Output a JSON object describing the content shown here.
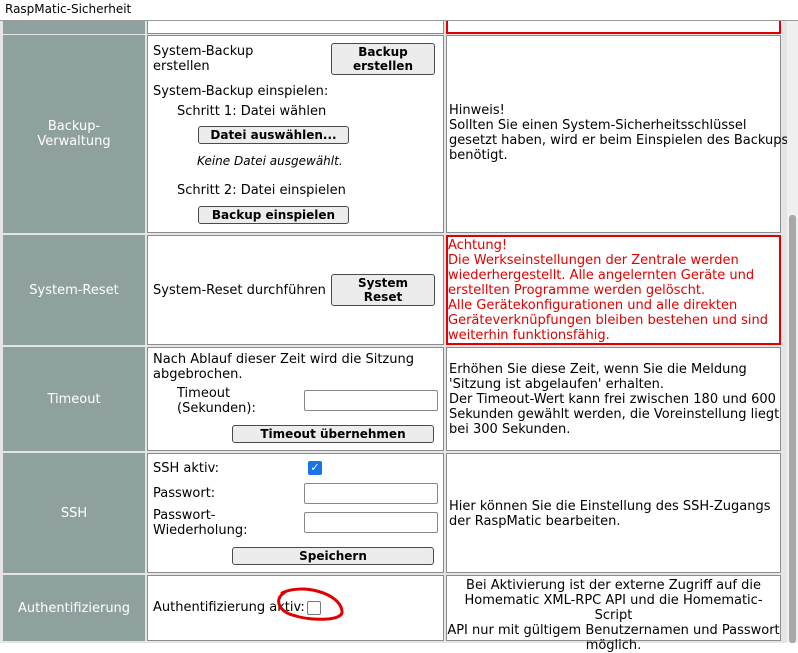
{
  "window": {
    "title": "RaspMatic-Sicherheit"
  },
  "backup": {
    "label": "Backup-\nVerwaltung",
    "create_text_1": "System-Backup",
    "create_text_2": "erstellen",
    "create_button": "Backup\nerstellen",
    "restore_title": "System-Backup einspielen:",
    "step1": "Schritt 1: Datei wählen",
    "choose_file_button": "Datei auswählen...",
    "no_file": "Keine Datei ausgewählt.",
    "step2": "Schritt 2: Datei einspielen",
    "restore_button": "Backup einspielen",
    "hint": "Hinweis!\nSollten Sie einen System-Sicherheitsschlüssel\ngesetzt haben, wird er beim Einspielen des Backups\nbenötigt."
  },
  "reset": {
    "label": "System-Reset",
    "text": "System-Reset durchführen",
    "button": "System\nReset",
    "warning": "Achtung!\nDie Werkseinstellungen der Zentrale werden\nwiederhergestellt. Alle angelernten Geräte und\nerstellten Programme werden gelöscht.\nAlle Gerätekonfigurationen und alle direkten\nGeräteverknüpfungen bleiben bestehen und sind\nweiterhin funktionsfähig."
  },
  "timeout": {
    "label": "Timeout",
    "text": "Nach Ablauf dieser Zeit wird die Sitzung\nabgebrochen.",
    "field_label": "Timeout\n(Sekunden):",
    "field_value": "",
    "button": "Timeout übernehmen",
    "hint": "Erhöhen Sie diese Zeit, wenn Sie die Meldung\n'Sitzung ist abgelaufen' erhalten.\nDer Timeout-Wert kann frei zwischen 180 und 600\nSekunden gewählt werden, die Voreinstellung liegt\nbei 300 Sekunden."
  },
  "ssh": {
    "label": "SSH",
    "active_label": "SSH aktiv:",
    "active_checked": true,
    "password_label": "Passwort:",
    "password_value": "",
    "repeat_label": "Passwort-\nWiederholung:",
    "repeat_value": "",
    "button": "Speichern",
    "hint": "Hier können Sie die Einstellung des SSH-Zugangs\nder RaspMatic bearbeiten."
  },
  "auth": {
    "label": "Authentifizierung",
    "text": "Authentifizierung aktiv:",
    "checked": false,
    "hint": "Bei Aktivierung ist der externe Zugriff auf die\nHomematic XML-RPC API und die Homematic-Script\nAPI nur mit gültigem Benutzernamen und Passwort\nmöglich."
  },
  "colors": {
    "label_bg": "#8fa19f",
    "warning": "#e00000",
    "accent": "#1a73e8",
    "annotation": "#e00000"
  }
}
